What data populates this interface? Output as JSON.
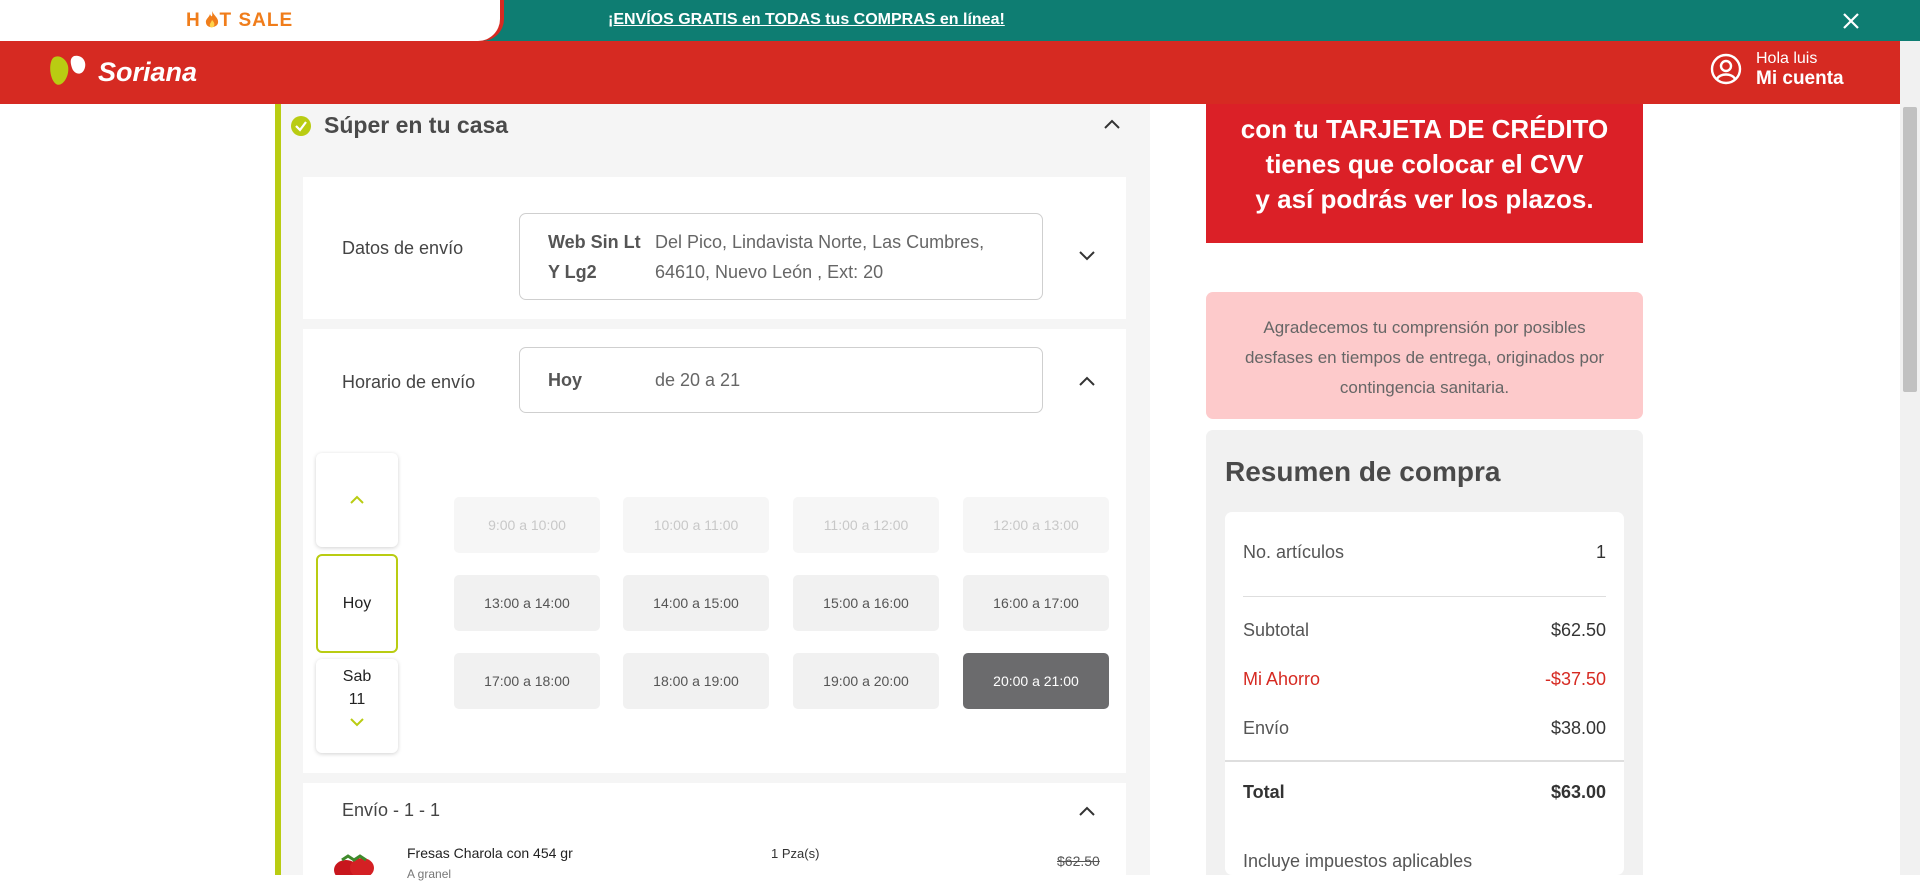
{
  "promo": {
    "hotsale_label": "H   T SALE",
    "message": "¡ENVÍOS GRATIS en TODAS tus COMPRAS en línea!"
  },
  "header": {
    "brand": "Soriana",
    "greeting": "Hola luis",
    "account_label": "Mi cuenta"
  },
  "section": {
    "title": "Súper en tu casa"
  },
  "shipping": {
    "label": "Datos de envío",
    "name_line1": "Web Sin Lt",
    "name_line2": "Y Lg2",
    "address_line1": "Del Pico, Lindavista Norte, Las Cumbres,",
    "address_line2": "64610, Nuevo León , Ext: 20"
  },
  "schedule": {
    "label": "Horario de envío",
    "selected_day": "Hoy",
    "selected_range": "de 20 a 21",
    "days": [
      {
        "label": "Hoy"
      },
      {
        "label": "Sab",
        "sub": "11"
      }
    ],
    "slots": [
      "9:00 a 10:00",
      "10:00 a 11:00",
      "11:00 a 12:00",
      "12:00 a 13:00",
      "13:00 a 14:00",
      "14:00 a 15:00",
      "15:00 a 16:00",
      "16:00 a 17:00",
      "17:00 a 18:00",
      "18:00 a 19:00",
      "19:00 a 20:00",
      "20:00 a 21:00"
    ]
  },
  "shipment": {
    "label": "Envío - 1 - 1",
    "product_name": "Fresas Charola con 454 gr",
    "product_sub": "A granel",
    "product_qty": "1 Pza(s)",
    "product_price": "$62.50"
  },
  "banner": {
    "line1": "con tu TARJETA DE CRÉDITO",
    "line2": "tienes que colocar el CVV",
    "line3": "y así podrás ver los plazos."
  },
  "notice": {
    "text": "Agradecemos tu comprensión por posibles desfases en tiempos de entrega, originados por contingencia sanitaria."
  },
  "summary": {
    "title": "Resumen de compra",
    "items_label": "No. artículos",
    "items_value": "1",
    "subtotal_label": "Subtotal",
    "subtotal_value": "$62.50",
    "savings_label": "Mi Ahorro",
    "savings_value": "-$37.50",
    "shipping_label": "Envío",
    "shipping_value": "$38.00",
    "total_label": "Total",
    "total_value": "$63.00",
    "taxes_note": "Incluye impuestos aplicables"
  },
  "colors": {
    "brand_red": "#d62a22",
    "promo_teal": "#0e7d72",
    "accent_green": "#b9cc12",
    "selected_slot": "#6b6b6d"
  }
}
